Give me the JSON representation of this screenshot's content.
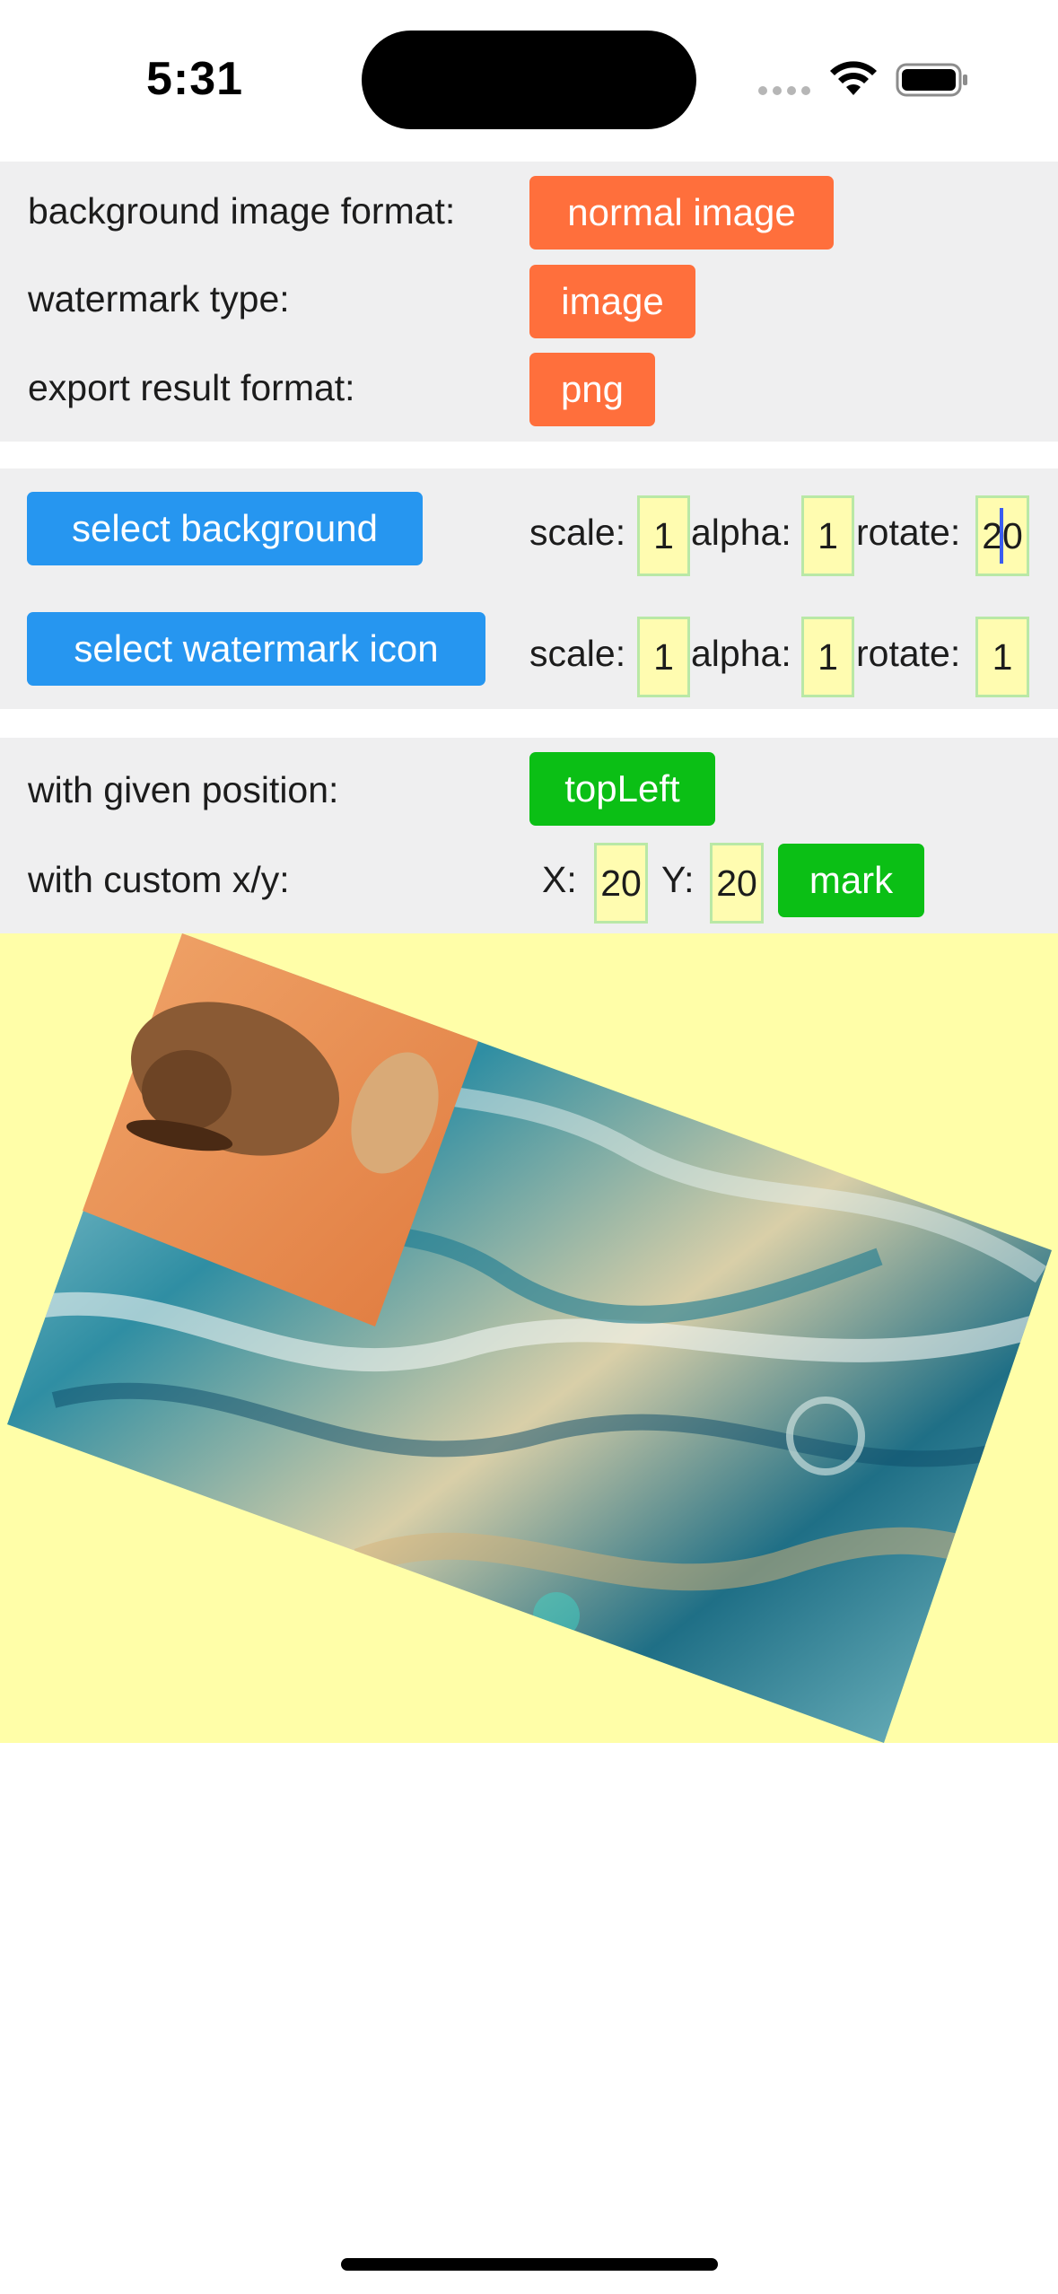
{
  "status_bar": {
    "time": "5:31"
  },
  "options": {
    "background_format": {
      "label": "background image format:",
      "value": "normal image"
    },
    "watermark_type": {
      "label": "watermark type:",
      "value": "image"
    },
    "export_format": {
      "label": "export result format:",
      "value": "png"
    }
  },
  "background_controls": {
    "button_label": "select background",
    "scale_label": "scale:",
    "scale_value": "1",
    "alpha_label": "alpha:",
    "alpha_value": "1",
    "rotate_label": "rotate:",
    "rotate_value": "20"
  },
  "watermark_controls": {
    "button_label": "select watermark icon",
    "scale_label": "scale:",
    "scale_value": "1",
    "alpha_label": "alpha:",
    "alpha_value": "1",
    "rotate_label": "rotate:",
    "rotate_value": "1"
  },
  "position": {
    "given_label": "with given position:",
    "given_value": "topLeft",
    "custom_label": "with custom x/y:",
    "x_label": "X:",
    "x_value": "20",
    "y_label": "Y:",
    "y_value": "20",
    "mark_label": "mark"
  },
  "colors": {
    "orange_button": "#ff6f3c",
    "blue_button": "#2696f0",
    "green_button": "#0bbf15",
    "field_background": "#fffcb0",
    "field_border": "#b9e8a6",
    "preview_background": "#fffea8",
    "panel_background": "#efeff0"
  },
  "icons": {
    "wifi": "wifi-icon",
    "battery": "battery-icon",
    "signal": "signal-dots-icon"
  }
}
